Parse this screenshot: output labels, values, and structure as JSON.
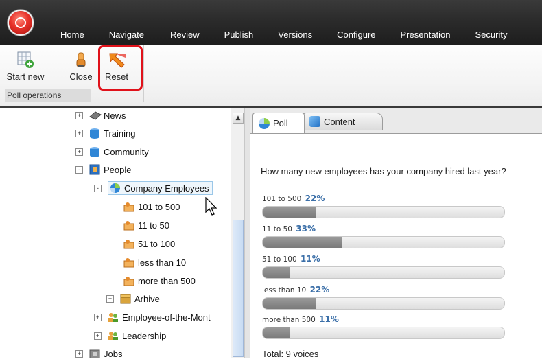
{
  "menu": [
    "Home",
    "Navigate",
    "Review",
    "Publish",
    "Versions",
    "Configure",
    "Presentation",
    "Security"
  ],
  "ribbon": {
    "buttons": [
      {
        "label": "Start new",
        "icon": "grid-add-icon"
      },
      {
        "label": "Close",
        "icon": "hand-stop-icon"
      },
      {
        "label": "Reset",
        "icon": "reset-arrow-icon"
      }
    ],
    "group_label": "Poll operations"
  },
  "tree": [
    {
      "label": "News",
      "icon": "news-icon",
      "expander": "+"
    },
    {
      "label": "Training",
      "icon": "database-icon",
      "expander": "+"
    },
    {
      "label": "Community",
      "icon": "database-icon",
      "expander": "+"
    },
    {
      "label": "People",
      "icon": "people-folder-icon",
      "expander": "-"
    },
    {
      "label": "Company Employees",
      "icon": "poll-icon",
      "expander": "-",
      "selected": true
    },
    {
      "label": "101 to 500",
      "icon": "answer-icon"
    },
    {
      "label": "11 to 50",
      "icon": "answer-icon"
    },
    {
      "label": "51 to 100",
      "icon": "answer-icon"
    },
    {
      "label": "less than 10",
      "icon": "answer-icon"
    },
    {
      "label": "more than 500",
      "icon": "answer-icon"
    },
    {
      "label": "Arhive",
      "icon": "archive-icon",
      "expander": "+"
    },
    {
      "label": "Employee-of-the-Mont",
      "icon": "users-icon",
      "expander": "+"
    },
    {
      "label": "Leadership",
      "icon": "users-icon",
      "expander": "+"
    },
    {
      "label": "Jobs",
      "icon": "jobs-icon",
      "expander": "+"
    }
  ],
  "tabs": [
    {
      "label": "Poll",
      "icon": "poll-icon",
      "active": true
    },
    {
      "label": "Content",
      "icon": "content-cube-icon",
      "active": false
    }
  ],
  "poll": {
    "question": "How many new employees has your company hired last year?",
    "answers": [
      {
        "label": "101 to 500",
        "percent": "22%",
        "fraction": 0.22
      },
      {
        "label": "11 to 50",
        "percent": "33%",
        "fraction": 0.33
      },
      {
        "label": "51 to 100",
        "percent": "11%",
        "fraction": 0.11
      },
      {
        "label": "less than 10",
        "percent": "22%",
        "fraction": 0.22
      },
      {
        "label": "more than 500",
        "percent": "11%",
        "fraction": 0.11
      }
    ],
    "total": "Total: 9 voices"
  },
  "colors": {
    "highlight": "#e0121b",
    "percent_text": "#3b6fa8",
    "bar_fill": "#8a8a8a"
  }
}
